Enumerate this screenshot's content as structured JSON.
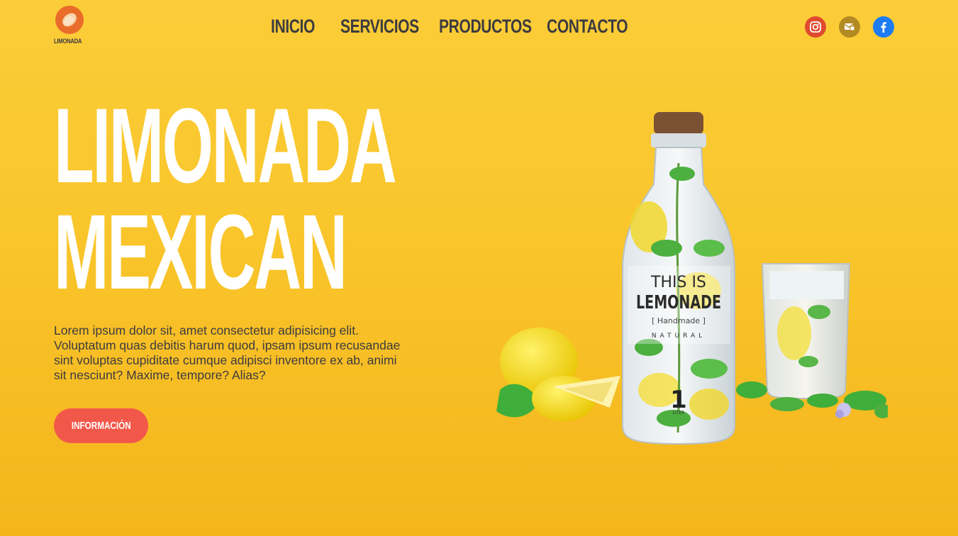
{
  "brand": {
    "name": "LIMONADA",
    "logo_color": "#e96c2a"
  },
  "nav": {
    "items": [
      {
        "label": "INICIO"
      },
      {
        "label": "SERVICIOS"
      },
      {
        "label": "PRODUCTOS"
      },
      {
        "label": "CONTACTO"
      }
    ]
  },
  "socials": [
    {
      "icon": "instagram-icon",
      "color": "#e04a2e"
    },
    {
      "icon": "mail-icon",
      "color": "#b38a21"
    },
    {
      "icon": "facebook-icon",
      "color": "#1d7cf2"
    }
  ],
  "hero": {
    "title_line1": "LIMONADA",
    "title_line2": "MEXICAN",
    "description": "Lorem ipsum dolor sit, amet consectetur adipisicing elit. Voluptatum quas debitis harum quod, ipsam ipsum recusandae sint voluptas cupiditate cumque adipisci inventore ex ab, animi sit nesciunt? Maxime, tempore? Alias?",
    "button_label": "INFORMACIÓN",
    "button_color": "#f2584a"
  },
  "product_label": {
    "line1": "THIS IS",
    "line2": "LEMONADE",
    "line3": "[ Handmade ]",
    "line4": "NATURAL",
    "volume": "1",
    "unit": "LITER"
  },
  "colors": {
    "background": "#f9c52b",
    "text_dark": "#3d3b40",
    "title": "#ffffff"
  }
}
